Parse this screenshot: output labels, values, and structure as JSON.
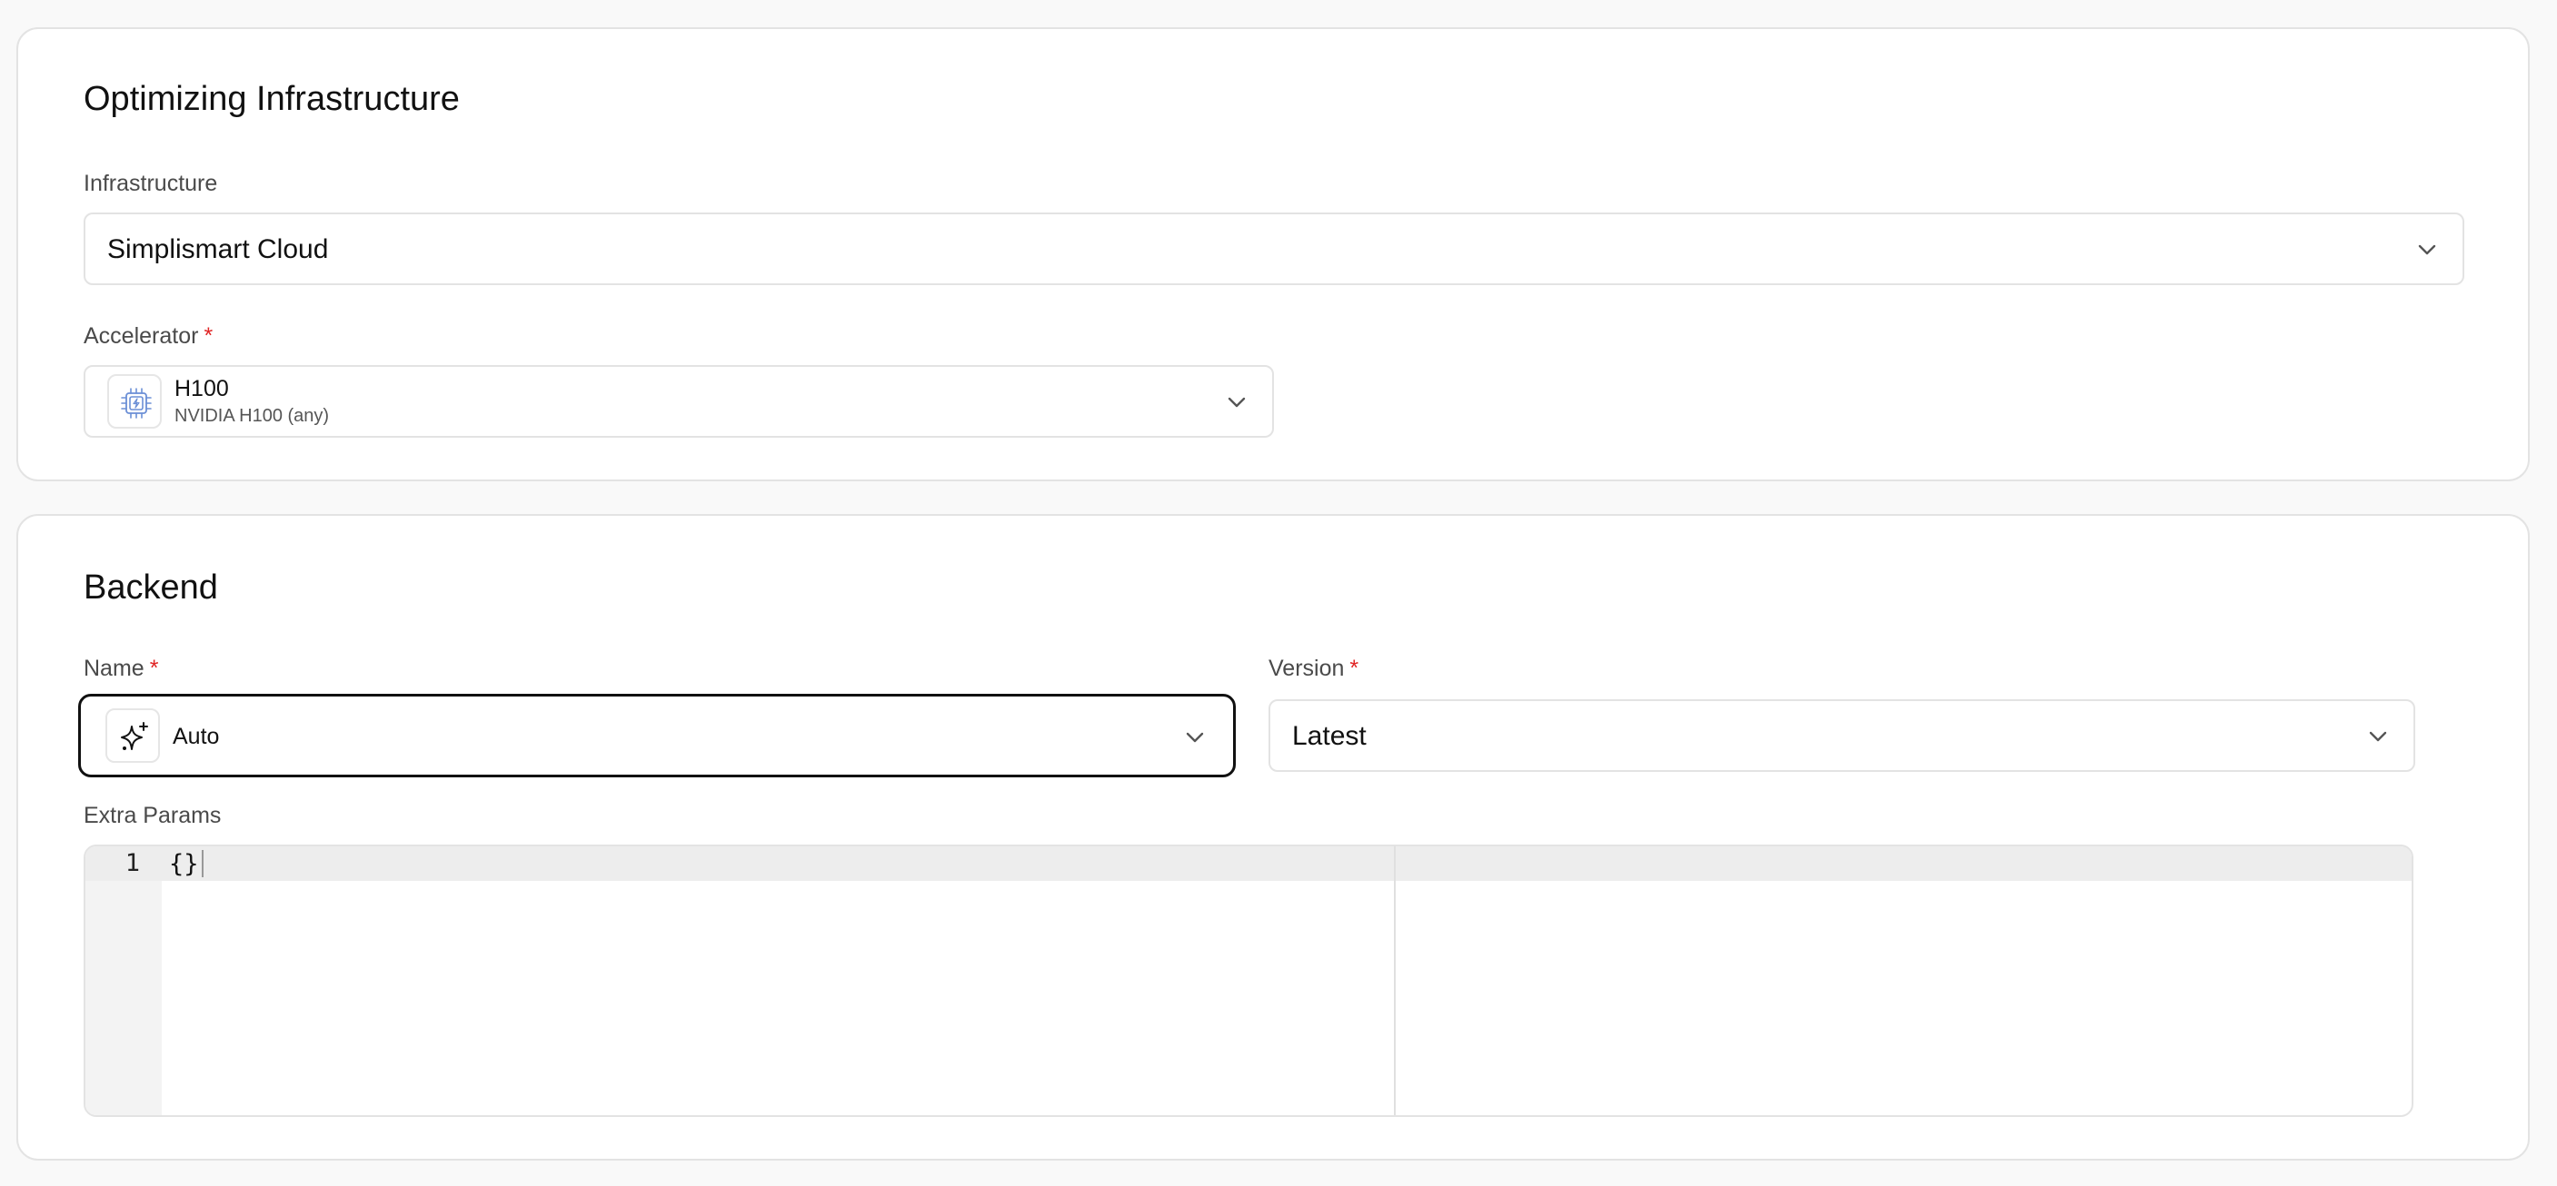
{
  "infra_section": {
    "title": "Optimizing Infrastructure",
    "infrastructure": {
      "label": "Infrastructure",
      "value": "Simplismart Cloud"
    },
    "accelerator": {
      "label": "Accelerator",
      "required_mark": "*",
      "value_title": "H100",
      "value_subtitle": "NVIDIA H100 (any)",
      "icon": "gpu-chip-icon"
    }
  },
  "backend_section": {
    "title": "Backend",
    "name": {
      "label": "Name",
      "required_mark": "*",
      "value": "Auto",
      "icon": "sparkles-icon"
    },
    "version": {
      "label": "Version",
      "required_mark": "*",
      "value": "Latest"
    },
    "extra_params": {
      "label": "Extra Params",
      "line_numbers": [
        "1"
      ],
      "code": "{}"
    }
  },
  "colors": {
    "required": "#e02424",
    "focus_border": "#111111",
    "card_border": "#e3e3e3",
    "chip_icon": "#6b8fd6"
  }
}
